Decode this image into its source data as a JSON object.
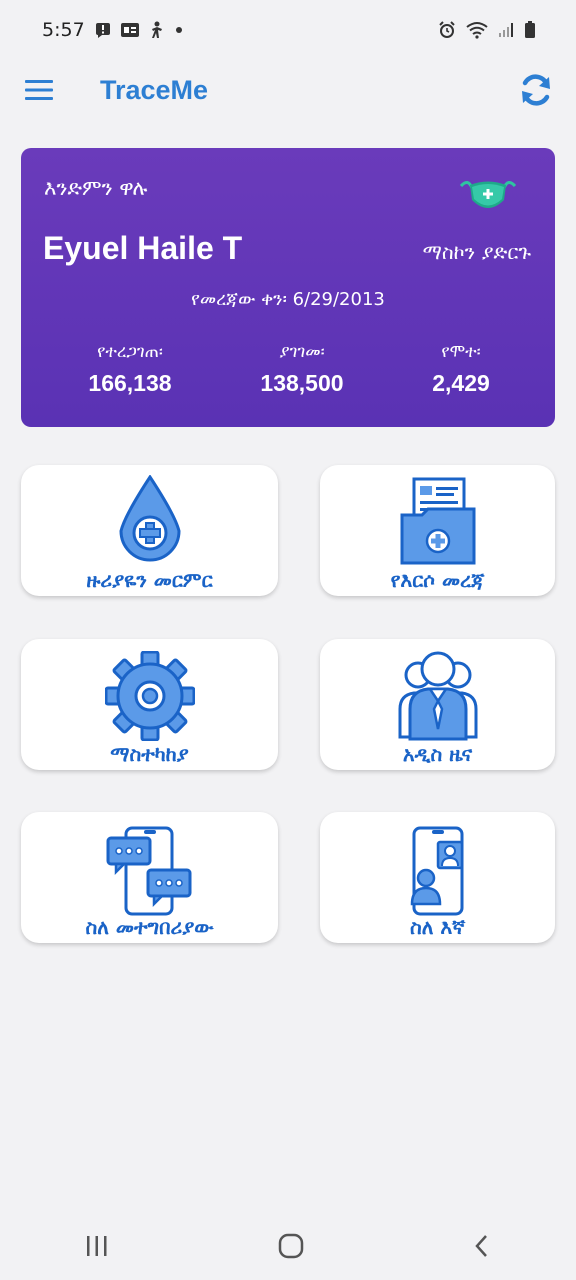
{
  "status_bar": {
    "time": "5:57"
  },
  "app_bar": {
    "title": "TraceMe"
  },
  "hero": {
    "greeting": "እንድምን ዋሉ",
    "user_name": "Eyuel Haile T",
    "mask_link": "ማስኮን ያድርጉ",
    "data_date": "የመረጃው ቀን፡ 6/29/2013",
    "stats": [
      {
        "label": "የተረጋገጠ፡",
        "value": "166,138"
      },
      {
        "label": "ያገገመ፡",
        "value": "138,500"
      },
      {
        "label": "የሞተ፡",
        "value": "2,429"
      }
    ]
  },
  "tiles": [
    {
      "label": "ዙሪያዬን መርምር",
      "icon": "drop-cross-icon"
    },
    {
      "label": "የእርሶ መረጃ",
      "icon": "medical-folder-icon"
    },
    {
      "label": "ማስተካከያ",
      "icon": "gear-icon"
    },
    {
      "label": "አዲስ ዜና",
      "icon": "group-icon"
    },
    {
      "label": "ስለ መተግበሪያው",
      "icon": "chat-phone-icon"
    },
    {
      "label": "ስለ እኛ",
      "icon": "contact-phone-icon"
    }
  ],
  "colors": {
    "accent": "#2d7fd3",
    "card": "#5f35b7",
    "tile_text": "#1a63c7",
    "icon_fill": "#5b9ae8"
  }
}
